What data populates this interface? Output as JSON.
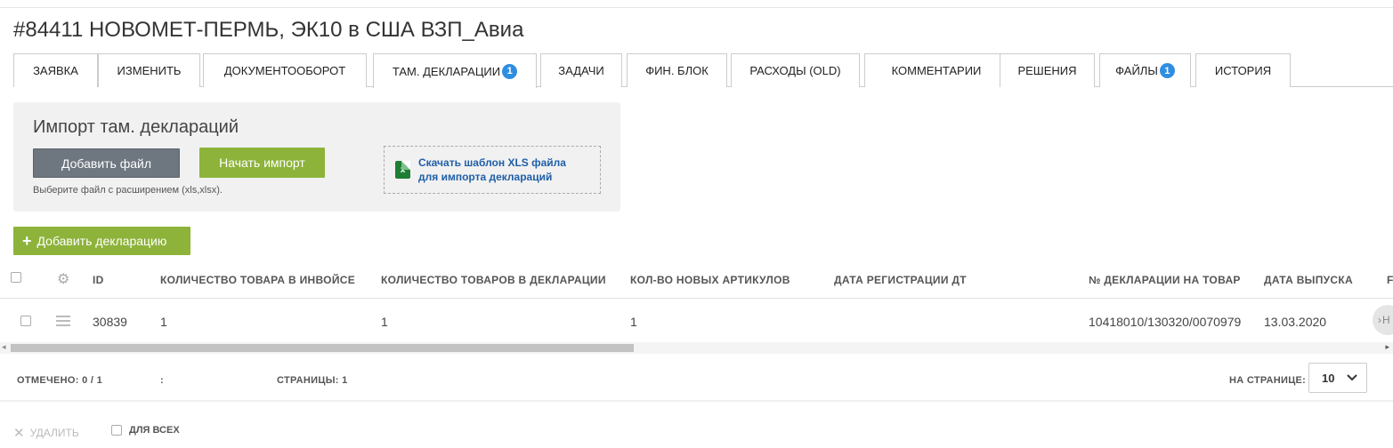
{
  "page_title": "#84411 НОВОМЕТ-ПЕРМЬ, ЭК10 в США ВЗП_Авиа",
  "tabs": [
    {
      "label": "ЗАЯВКА"
    },
    {
      "label": "ИЗМЕНИТЬ"
    },
    {
      "label": "ДОКУМЕНТООБОРОТ"
    },
    {
      "label": "ТАМ. ДЕКЛАРАЦИИ",
      "badge": "1",
      "active": true
    },
    {
      "label": "ЗАДАЧИ"
    },
    {
      "label": "ФИН. БЛОК"
    },
    {
      "label": "РАСХОДЫ (OLD)"
    },
    {
      "label": "КОММЕНТАРИИ"
    },
    {
      "label": "РЕШЕНИЯ"
    },
    {
      "label": "ФАЙЛЫ",
      "badge": "1"
    },
    {
      "label": "ИСТОРИЯ"
    }
  ],
  "import": {
    "title": "Импорт там. деклараций",
    "add_file_label": "Добавить файл",
    "start_import_label": "Начать импорт",
    "hint": "Выберите файл с расширением (xls,xlsx).",
    "template_link_line1": "Скачать шаблон XLS файла",
    "template_link_line2": "для импорта деклараций",
    "xls_icon_letter": "x"
  },
  "add_declaration_label": "Добавить декларацию",
  "table": {
    "columns": [
      "ID",
      "КОЛИЧЕСТВО ТОВАРА В ИНВОЙСЕ",
      "КОЛИЧЕСТВО ТОВАРОВ В ДЕКЛАРАЦИИ",
      "КОЛ-ВО НОВЫХ АРТИКУЛОВ",
      "ДАТА РЕГИСТРАЦИИ ДТ",
      "№ ДЕКЛАРАЦИИ НА ТОВАР",
      "ДАТА ВЫПУСКА",
      "F"
    ],
    "rows": [
      {
        "id": "30839",
        "qty_invoice": "1",
        "qty_declaration": "1",
        "new_articles": "1",
        "reg_date": "",
        "declaration_no": "10418010/130320/0070979",
        "release_date": "13.03.2020",
        "cut_off": "Н"
      }
    ]
  },
  "footer": {
    "marked_label": "ОТМЕЧЕНО:",
    "marked_value": "0 / 1",
    "colon": ":",
    "pages_label": "СТРАНИЦЫ:",
    "pages_value": "1",
    "per_page_label": "НА СТРАНИЦЕ:",
    "per_page_value": "10"
  },
  "bulk": {
    "delete_label": "УДАЛИТЬ",
    "for_all_label": "ДЛЯ ВСЕХ"
  },
  "icons": {
    "settings": "gear-icon",
    "drag": "drag-handle-icon",
    "chevron": "chevron-down-icon",
    "delete": "close-icon",
    "plus": "plus-icon",
    "xls": "xls-file-icon"
  },
  "colors": {
    "accent_green": "#8db33a",
    "badge_blue": "#2f8ee0",
    "link_blue": "#1f5fa8",
    "button_gray": "#6e7780"
  }
}
